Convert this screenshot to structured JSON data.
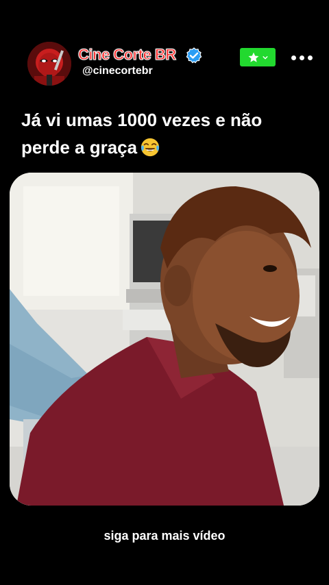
{
  "header": {
    "channel_name": "Cine Corte BR",
    "handle": "@cinecortebr",
    "avatar_icon": "deadpool-avatar-icon",
    "verified_icon": "verified-badge-icon",
    "star_button_icon": "star-icon",
    "star_button_color": "#22d92f",
    "more_icon": "more-dots-icon"
  },
  "post": {
    "caption_line1": "Já vi umas 1000 vezes e não",
    "caption_line2": "perde a graça",
    "caption_emoji": "face-with-tears-of-joy-icon",
    "video_thumbnail": "video-frame-man-laughing-clinic"
  },
  "footer": {
    "text": "siga para mais vídeo"
  },
  "colors": {
    "background": "#000000",
    "channel_name": "#ff2e2e",
    "accent_green": "#22d92f",
    "verified_blue": "#2a9df4"
  }
}
